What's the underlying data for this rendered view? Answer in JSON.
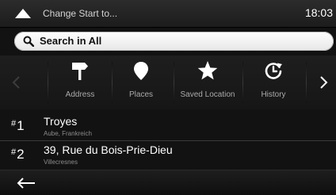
{
  "topbar": {
    "title": "Change Start to...",
    "time": "18:03"
  },
  "search": {
    "label": "Search in All"
  },
  "categories": [
    {
      "label": "Address",
      "icon": "signpost-icon"
    },
    {
      "label": "Places",
      "icon": "place-pin-icon"
    },
    {
      "label": "Saved Location",
      "icon": "star-icon"
    },
    {
      "label": "History",
      "icon": "history-icon"
    }
  ],
  "history": [
    {
      "rank": "1",
      "title": "Troyes",
      "subtitle": "Aube, Frankreich"
    },
    {
      "rank": "2",
      "title": "39, Rue du Bois-Prie-Dieu",
      "subtitle": "Villecresnes"
    }
  ],
  "colors": {
    "background": "#121212",
    "search_bg": "#ffffff",
    "text": "#ffffff",
    "muted": "#8c8c8c"
  }
}
